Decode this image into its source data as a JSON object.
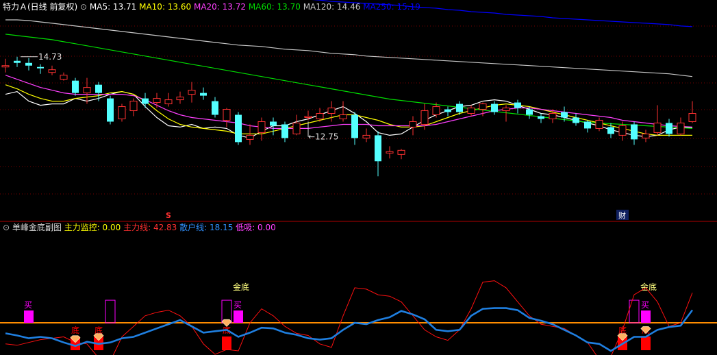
{
  "colors": {
    "background": "#000000",
    "grid": "#7a0000",
    "up": "#ff3232",
    "down": "#54ffff",
    "ma5": "#ffffff",
    "ma10": "#ffff00",
    "ma20": "#ff40ff",
    "ma60": "#00dd00",
    "ma120": "#c8c8c8",
    "ma250": "#0000ff",
    "main_line": "#ff1010",
    "retail_line": "#1f7fe0",
    "zero_line": "#ff8c00",
    "buy": "#ff00ff",
    "bottom": "#ff0000",
    "gold_text": "#ffff80",
    "diamond": "#ffb060"
  },
  "top_panel": {
    "stock_label": "特力Ａ(日线 前复权)",
    "indicators": [
      {
        "name": "MA5",
        "value": "13.71",
        "color": "#ffffff"
      },
      {
        "name": "MA10",
        "value": "13.60",
        "color": "#ffff00"
      },
      {
        "name": "MA20",
        "value": "13.72",
        "color": "#ff40ff"
      },
      {
        "name": "MA60",
        "value": "13.70",
        "color": "#00dd00"
      },
      {
        "name": "MA120",
        "value": "14.46",
        "color": "#c8c8c8"
      },
      {
        "name": "MA250",
        "value": "15.19",
        "color": "#0000ff"
      }
    ],
    "high_label": "14.73",
    "low_label": "12.75",
    "marker_s": "S",
    "marker_cai": "财"
  },
  "sub_panel": {
    "title": "单峰金底副图",
    "indicators": [
      {
        "name": "主力监控",
        "value": "0.00",
        "color": "#ffff00"
      },
      {
        "name": "主力线",
        "value": "42.83",
        "color": "#ff3030"
      },
      {
        "name": "散户线",
        "value": "18.15",
        "color": "#3090ff"
      },
      {
        "name": "低吸",
        "value": "0.00",
        "color": "#ff40ff"
      }
    ],
    "buy_text": "买",
    "bottom_text": "底",
    "gold_bottom_text": "金底"
  },
  "chart_data": [
    {
      "type": "candlestick",
      "title": "",
      "ylim": [
        12.35,
        15.4
      ],
      "n": 60,
      "candles": [
        [
          14.6,
          14.62,
          14.72,
          14.52
        ],
        [
          14.69,
          14.66,
          14.75,
          14.6
        ],
        [
          14.66,
          14.62,
          14.73,
          14.55
        ],
        [
          14.6,
          14.58,
          14.64,
          14.5
        ],
        [
          14.52,
          14.56,
          14.62,
          14.48
        ],
        [
          14.42,
          14.48,
          14.52,
          14.4
        ],
        [
          14.4,
          14.22,
          14.44,
          14.18
        ],
        [
          14.22,
          14.3,
          14.44,
          14.06
        ],
        [
          14.34,
          14.22,
          14.38,
          14.1
        ],
        [
          14.14,
          13.8,
          14.18,
          13.76
        ],
        [
          13.84,
          14.02,
          14.06,
          13.8
        ],
        [
          13.96,
          14.1,
          14.14,
          13.88
        ],
        [
          14.14,
          14.06,
          14.22,
          14.0
        ],
        [
          14.08,
          14.14,
          14.22,
          14.0
        ],
        [
          14.06,
          14.12,
          14.22,
          14.02
        ],
        [
          14.12,
          14.16,
          14.24,
          14.06
        ],
        [
          14.2,
          14.26,
          14.38,
          14.08
        ],
        [
          14.22,
          14.18,
          14.3,
          14.12
        ],
        [
          14.1,
          13.9,
          14.16,
          13.86
        ],
        [
          13.82,
          13.98,
          14.0,
          13.72
        ],
        [
          13.9,
          13.5,
          13.94,
          13.46
        ],
        [
          13.54,
          13.6,
          13.76,
          13.46
        ],
        [
          13.64,
          13.8,
          13.86,
          13.52
        ],
        [
          13.8,
          13.74,
          13.86,
          13.6
        ],
        [
          13.76,
          13.56,
          13.8,
          13.5
        ],
        [
          13.62,
          13.78,
          13.9,
          13.6
        ],
        [
          13.86,
          13.88,
          13.96,
          13.82
        ],
        [
          13.84,
          13.92,
          14.0,
          13.8
        ],
        [
          13.92,
          14.0,
          14.1,
          13.8
        ],
        [
          13.84,
          13.9,
          14.1,
          13.8
        ],
        [
          13.9,
          13.56,
          13.94,
          13.46
        ],
        [
          13.56,
          13.6,
          13.7,
          13.5
        ],
        [
          13.6,
          13.22,
          13.66,
          13.0
        ],
        [
          13.34,
          13.36,
          13.44,
          13.26
        ],
        [
          13.32,
          13.38,
          13.4,
          13.25
        ],
        [
          13.72,
          13.8,
          13.88,
          13.6
        ],
        [
          13.76,
          13.96,
          14.06,
          13.68
        ],
        [
          13.9,
          14.02,
          14.08,
          13.86
        ],
        [
          13.98,
          13.94,
          14.02,
          13.88
        ],
        [
          14.06,
          13.94,
          14.1,
          13.9
        ],
        [
          13.92,
          14.0,
          14.04,
          13.88
        ],
        [
          13.98,
          14.06,
          14.08,
          13.88
        ],
        [
          14.06,
          13.94,
          14.1,
          13.9
        ],
        [
          13.96,
          14.0,
          14.04,
          13.8
        ],
        [
          14.08,
          14.0,
          14.12,
          13.92
        ],
        [
          13.98,
          13.9,
          14.02,
          13.84
        ],
        [
          13.88,
          13.84,
          13.92,
          13.78
        ],
        [
          13.84,
          13.92,
          13.98,
          13.78
        ],
        [
          13.94,
          13.86,
          14.02,
          13.8
        ],
        [
          13.86,
          13.78,
          13.92,
          13.74
        ],
        [
          13.8,
          13.7,
          13.82,
          13.64
        ],
        [
          13.7,
          13.82,
          13.86,
          13.66
        ],
        [
          13.72,
          13.62,
          13.78,
          13.56
        ],
        [
          13.6,
          13.74,
          13.8,
          13.52
        ],
        [
          13.76,
          13.54,
          13.8,
          13.46
        ],
        [
          13.56,
          13.62,
          13.68,
          13.5
        ],
        [
          13.64,
          13.78,
          14.04,
          13.6
        ],
        [
          13.78,
          13.62,
          13.84,
          13.58
        ],
        [
          13.62,
          13.78,
          13.86,
          13.6
        ],
        [
          13.8,
          13.92,
          14.1,
          13.78
        ]
      ],
      "series": [
        {
          "name": "MA5",
          "values": [
            14.2,
            14.24,
            14.1,
            14.04,
            14.06,
            14.06,
            14.14,
            14.1,
            14.14,
            14.2,
            14.24,
            14.2,
            14.02,
            13.86,
            13.74,
            13.72,
            13.76,
            13.7,
            13.72,
            13.7,
            13.6,
            13.56,
            13.66,
            13.74,
            13.74,
            13.8,
            13.84,
            13.9,
            13.96,
            14.02,
            13.92,
            13.8,
            13.64,
            13.6,
            13.62,
            13.72,
            13.82,
            13.9,
            13.96,
            14.02,
            14.04,
            14.1,
            14.12,
            14.1,
            14.04,
            13.98,
            13.92,
            13.9,
            13.86,
            13.82,
            13.78,
            13.74,
            13.68,
            13.64,
            13.6,
            13.58,
            13.6,
            13.68,
            13.72,
            13.71
          ]
        },
        {
          "name": "MA10",
          "values": [
            14.34,
            14.28,
            14.2,
            14.14,
            14.1,
            14.1,
            14.14,
            14.16,
            14.18,
            14.22,
            14.24,
            14.2,
            14.1,
            13.96,
            13.84,
            13.76,
            13.72,
            13.7,
            13.68,
            13.66,
            13.62,
            13.62,
            13.62,
            13.66,
            13.7,
            13.74,
            13.78,
            13.82,
            13.86,
            13.9,
            13.9,
            13.86,
            13.82,
            13.76,
            13.72,
            13.72,
            13.74,
            13.8,
            13.86,
            13.92,
            13.96,
            14.0,
            14.04,
            14.06,
            14.04,
            14.02,
            13.98,
            13.94,
            13.9,
            13.86,
            13.82,
            13.78,
            13.74,
            13.7,
            13.66,
            13.62,
            13.6,
            13.6,
            13.6,
            13.6
          ]
        },
        {
          "name": "MA20",
          "values": [
            14.48,
            14.42,
            14.36,
            14.3,
            14.26,
            14.22,
            14.2,
            14.2,
            14.2,
            14.2,
            14.2,
            14.18,
            14.12,
            14.04,
            13.96,
            13.9,
            13.86,
            13.84,
            13.82,
            13.8,
            13.78,
            13.74,
            13.72,
            13.7,
            13.7,
            13.7,
            13.7,
            13.72,
            13.74,
            13.76,
            13.76,
            13.76,
            13.74,
            13.74,
            13.74,
            13.74,
            13.74,
            13.76,
            13.8,
            13.84,
            13.88,
            13.92,
            13.96,
            13.98,
            14.0,
            14.0,
            13.98,
            13.96,
            13.94,
            13.92,
            13.9,
            13.88,
            13.86,
            13.82,
            13.8,
            13.78,
            13.76,
            13.74,
            13.73,
            13.72
          ]
        },
        {
          "name": "MA60",
          "values": [
            15.08,
            15.06,
            15.04,
            15.02,
            15.0,
            14.97,
            14.94,
            14.91,
            14.88,
            14.85,
            14.82,
            14.79,
            14.76,
            14.73,
            14.7,
            14.67,
            14.64,
            14.61,
            14.58,
            14.55,
            14.52,
            14.49,
            14.46,
            14.43,
            14.4,
            14.37,
            14.34,
            14.31,
            14.28,
            14.25,
            14.22,
            14.19,
            14.16,
            14.13,
            14.11,
            14.09,
            14.07,
            14.05,
            14.03,
            14.01,
            13.99,
            13.97,
            13.95,
            13.93,
            13.91,
            13.89,
            13.87,
            13.85,
            13.83,
            13.81,
            13.79,
            13.78,
            13.77,
            13.76,
            13.75,
            13.74,
            13.73,
            13.72,
            13.71,
            13.7
          ]
        },
        {
          "name": "MA120",
          "values": [
            15.29,
            15.29,
            15.28,
            15.26,
            15.24,
            15.22,
            15.2,
            15.18,
            15.16,
            15.14,
            15.12,
            15.1,
            15.08,
            15.06,
            15.04,
            15.02,
            15.0,
            14.98,
            14.96,
            14.94,
            14.92,
            14.91,
            14.9,
            14.88,
            14.86,
            14.85,
            14.84,
            14.82,
            14.8,
            14.79,
            14.78,
            14.76,
            14.75,
            14.74,
            14.73,
            14.72,
            14.71,
            14.7,
            14.69,
            14.68,
            14.67,
            14.66,
            14.65,
            14.64,
            14.63,
            14.62,
            14.61,
            14.6,
            14.59,
            14.58,
            14.57,
            14.56,
            14.55,
            14.54,
            14.53,
            14.52,
            14.51,
            14.5,
            14.48,
            14.46
          ]
        },
        {
          "name": "MA250",
          "values": [
            15.85,
            15.84,
            15.83,
            15.82,
            15.81,
            15.8,
            15.79,
            15.78,
            15.77,
            15.76,
            15.75,
            15.74,
            15.73,
            15.72,
            15.71,
            15.7,
            15.69,
            15.68,
            15.67,
            15.66,
            15.65,
            15.64,
            15.63,
            15.62,
            15.61,
            15.6,
            15.59,
            15.58,
            15.56,
            15.55,
            15.54,
            15.53,
            15.52,
            15.51,
            15.5,
            15.48,
            15.47,
            15.46,
            15.44,
            15.43,
            15.41,
            15.4,
            15.39,
            15.37,
            15.36,
            15.35,
            15.34,
            15.32,
            15.31,
            15.3,
            15.29,
            15.28,
            15.27,
            15.26,
            15.25,
            15.24,
            15.23,
            15.22,
            15.2,
            15.19
          ]
        }
      ],
      "high_index": 1,
      "low_index": 26,
      "s_index": 14,
      "cai_index": 53
    },
    {
      "type": "line",
      "title": "",
      "ylim": [
        -40,
        130
      ],
      "zero_value": 0,
      "series": [
        {
          "name": "主力线",
          "values": [
            -30,
            -32,
            -28,
            -24,
            -22,
            -20,
            -28,
            -30,
            -50,
            -55,
            -20,
            -5,
            10,
            15,
            18,
            10,
            -5,
            -30,
            -45,
            -38,
            -40,
            0,
            20,
            10,
            -5,
            -15,
            -18,
            -30,
            -35,
            10,
            50,
            48,
            40,
            38,
            30,
            10,
            -10,
            -20,
            -25,
            -10,
            20,
            58,
            60,
            50,
            30,
            10,
            -2,
            -5,
            -8,
            -18,
            -28,
            -52,
            -48,
            -10,
            40,
            50,
            30,
            -5,
            0,
            42.83
          ]
        },
        {
          "name": "散户线",
          "values": [
            -15,
            -18,
            -22,
            -20,
            -22,
            -28,
            -33,
            -27,
            -30,
            -28,
            -22,
            -20,
            -14,
            -8,
            -2,
            4,
            -5,
            -14,
            -12,
            -10,
            -20,
            -14,
            -7,
            -8,
            -14,
            -17,
            -22,
            -24,
            -22,
            -10,
            0,
            -2,
            4,
            8,
            17,
            12,
            5,
            -10,
            -12,
            -10,
            10,
            20,
            21,
            21,
            18,
            7,
            3,
            -2,
            -10,
            -18,
            -28,
            -30,
            -40,
            -30,
            -20,
            -20,
            -10,
            -6,
            -4,
            18.15
          ]
        }
      ],
      "buy_indices": [
        2,
        20,
        55
      ],
      "buy_hollow_indices": [
        9,
        19,
        54
      ],
      "gold_bottom_indices": [
        20,
        55
      ],
      "bottom_indices": [
        6,
        8,
        19,
        53,
        55
      ],
      "diamond_indices": [
        6,
        8,
        19,
        53,
        55
      ]
    }
  ]
}
